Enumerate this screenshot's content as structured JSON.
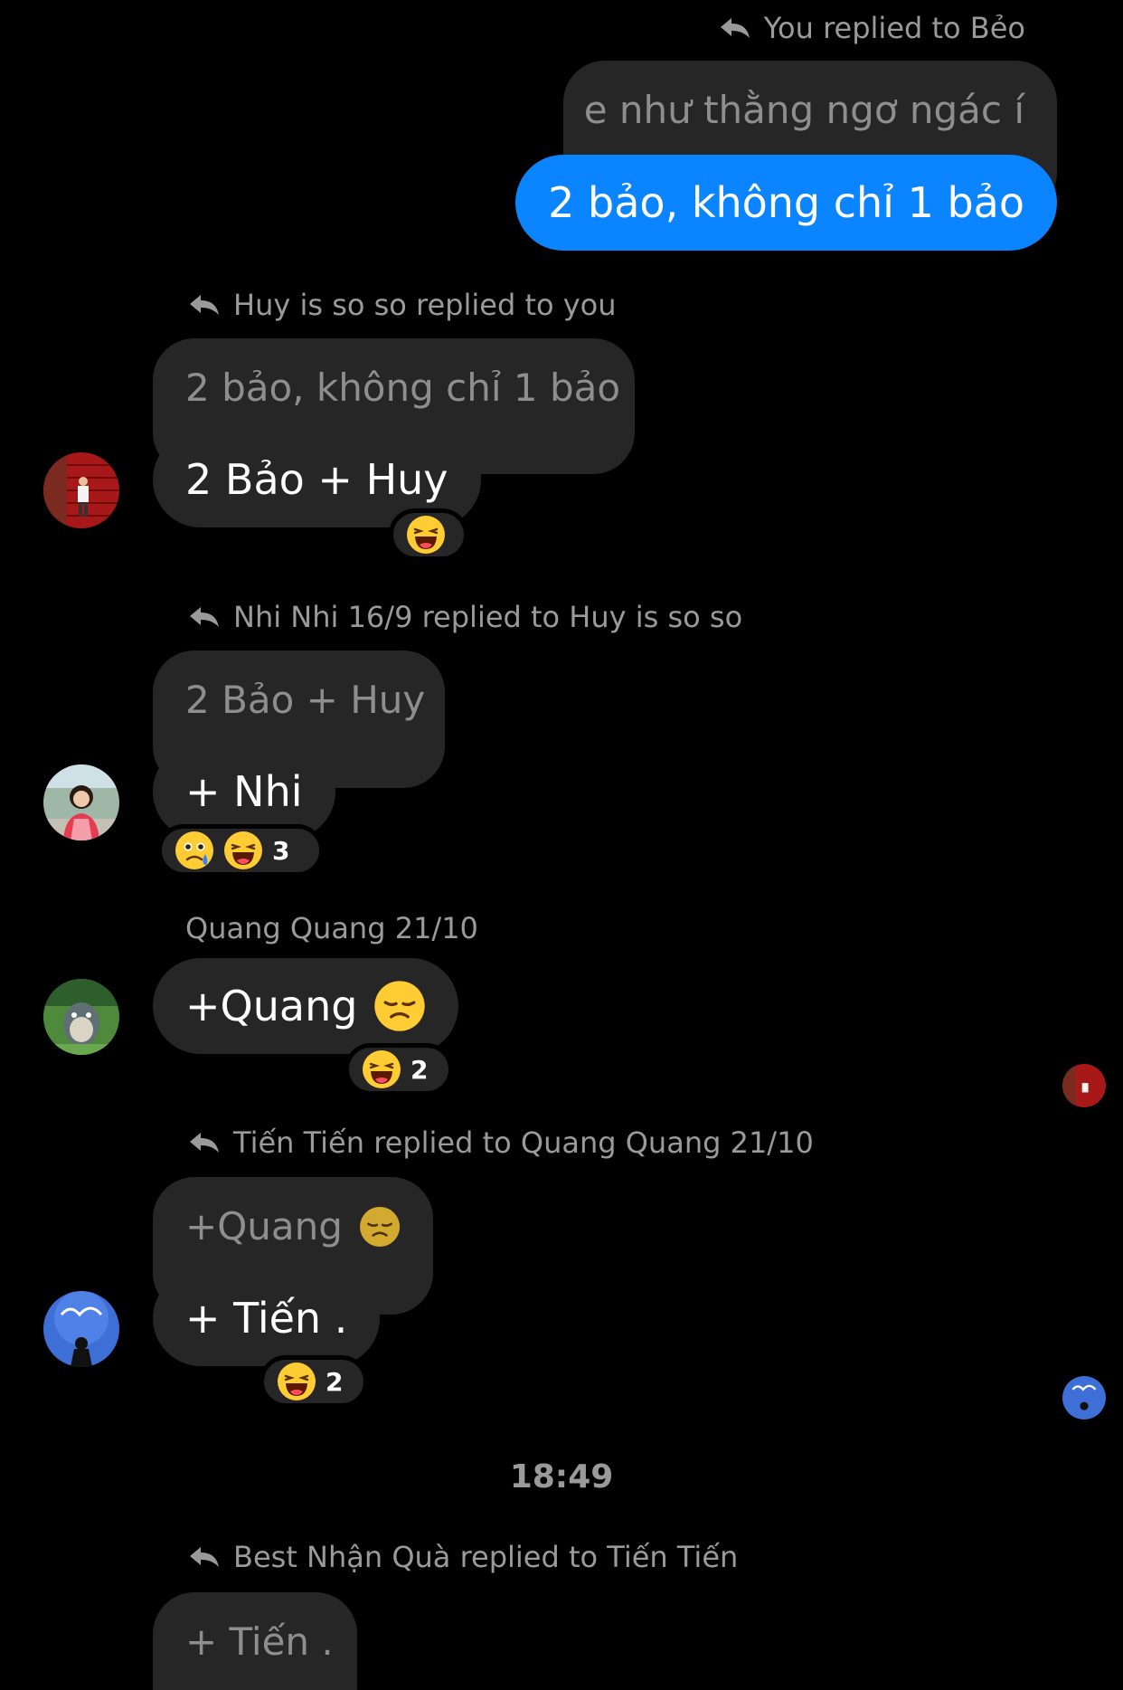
{
  "thread": [
    {
      "reply_header": "You replied to Bẻo",
      "quoted": "e như thằng ngơ ngác í",
      "message": "2 bảo, không chỉ 1 bảo"
    },
    {
      "reply_header": "Huy is so so replied to you",
      "quoted": "2 bảo, không chỉ 1 bảo",
      "message": "2 Bảo + Huy"
    },
    {
      "reply_header": "Nhi Nhi 16/9 replied to Huy is so so",
      "quoted": "2 Bảo + Huy",
      "message": "+ Nhi",
      "reaction_count": "3"
    },
    {
      "sender": "Quang Quang 21/10",
      "message": "+Quang",
      "reaction_count": "2"
    },
    {
      "reply_header": "Tiến Tiến replied to Quang Quang 21/10",
      "quoted": "+Quang",
      "message": "+ Tiến .",
      "reaction_count": "2"
    }
  ],
  "timestamp": "18:49",
  "last": {
    "reply_header": "Best Nhận Quà replied to Tiến Tiến",
    "quoted": "+ Tiến ."
  },
  "colors": {
    "background": "#000000",
    "bubble": "#262626",
    "my_bubble": "#0a84ff",
    "muted_text": "#9a9a9a"
  }
}
